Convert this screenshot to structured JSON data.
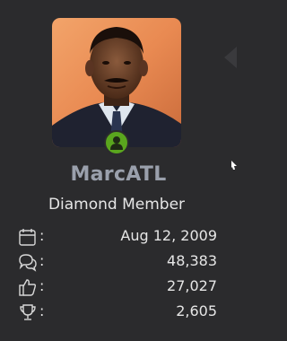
{
  "profile": {
    "username": "MarcATL",
    "rank": "Diamond Member",
    "status_color": "#5aa61e",
    "username_color": "#9aa0ac"
  },
  "stats": [
    {
      "icon": "calendar-icon",
      "label": ":",
      "value": "Aug 12, 2009"
    },
    {
      "icon": "messages-icon",
      "label": ":",
      "value": "48,383"
    },
    {
      "icon": "thumbs-up-icon",
      "label": ":",
      "value": "27,027"
    },
    {
      "icon": "trophy-icon",
      "label": ":",
      "value": "2,605"
    }
  ]
}
